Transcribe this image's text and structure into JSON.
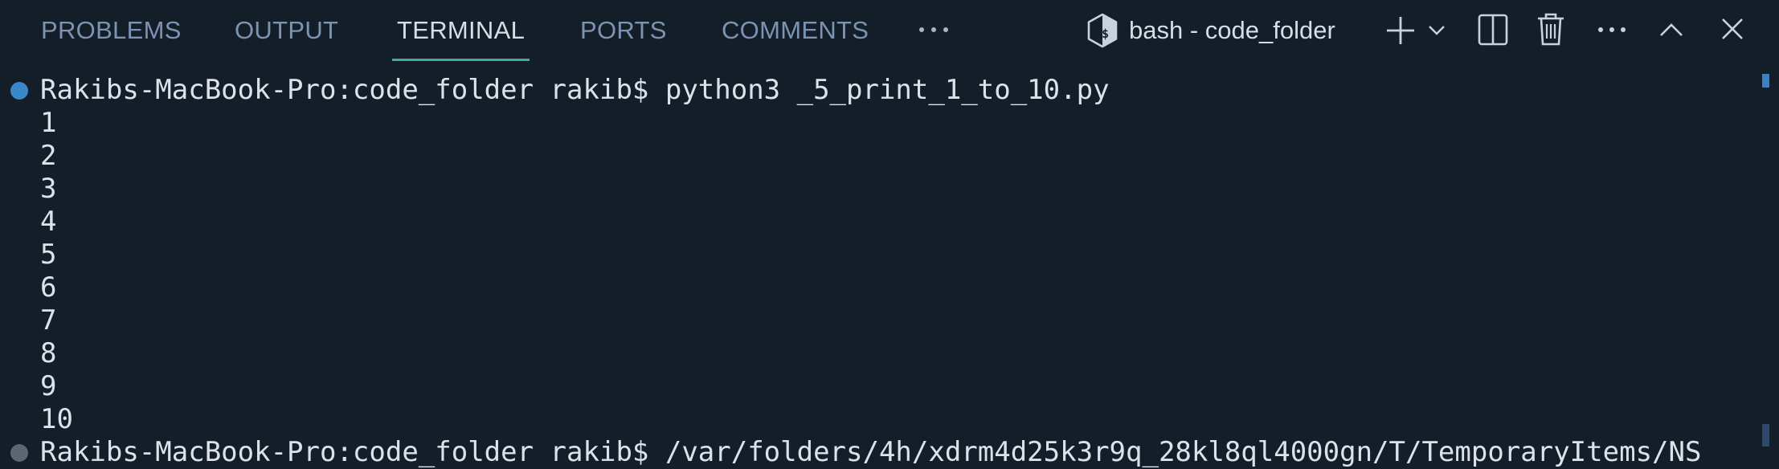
{
  "panel": {
    "tabs": [
      {
        "label": "PROBLEMS"
      },
      {
        "label": "OUTPUT"
      },
      {
        "label": "TERMINAL"
      },
      {
        "label": "PORTS"
      },
      {
        "label": "COMMENTS"
      }
    ],
    "active_tab": "TERMINAL",
    "more_icon": "ellipsis-icon",
    "terminal_name": "bash - code_folder",
    "actions": [
      {
        "icon": "terminal-bash-icon"
      },
      {
        "icon": "plus-icon"
      },
      {
        "icon": "chevron-down-icon"
      },
      {
        "icon": "split-editor-icon"
      },
      {
        "icon": "trash-icon"
      },
      {
        "icon": "ellipsis-icon"
      },
      {
        "icon": "chevron-up-icon"
      },
      {
        "icon": "close-icon"
      }
    ]
  },
  "terminal": {
    "prompt_command": "Rakibs-MacBook-Pro:code_folder rakib$ python3 _5_print_1_to_10.py",
    "output": [
      "1",
      "2",
      "3",
      "4",
      "5",
      "6",
      "7",
      "8",
      "9",
      "10"
    ],
    "next_prompt_partial": "Rakibs-MacBook-Pro:code_folder rakib$ /var/folders/4h/xdrm4d25k3r9q_28kl8ql4000gn/T/TemporaryItems/NS",
    "colors": {
      "background": "#131e29",
      "text": "#dde2ea",
      "decoration_dot": "#3a87c9",
      "active_tab_underline": "#3fa9a2",
      "scrollbar_marker": "#3b82c4"
    }
  }
}
